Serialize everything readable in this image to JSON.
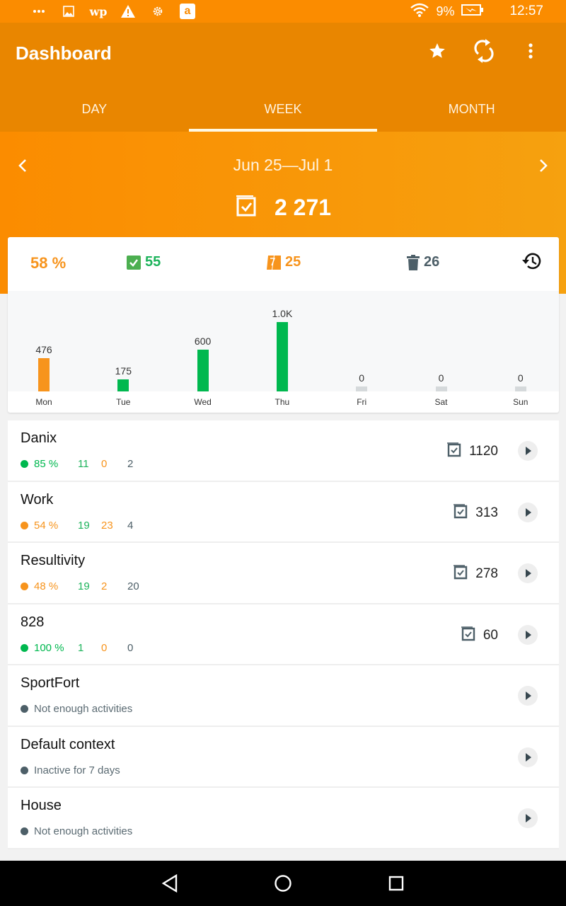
{
  "status_bar": {
    "notification_icons": [
      "more-dots-icon",
      "image-icon",
      "washington-post-icon",
      "warning-icon",
      "settings-icon",
      "amazon-icon"
    ],
    "wp_glyph": "wp",
    "amazon_glyph": "a",
    "battery": "9%",
    "time": "12:57"
  },
  "app_bar": {
    "title": "Dashboard",
    "actions": [
      "star-icon",
      "sync-icon",
      "more-vert-icon"
    ]
  },
  "tabs": [
    {
      "label": "DAY",
      "active": false
    },
    {
      "label": "WEEK",
      "active": true
    },
    {
      "label": "MONTH",
      "active": false
    }
  ],
  "period": {
    "range": "Jun 25—Jul 1",
    "prev_glyph": "‹",
    "next_glyph": "›",
    "total": "2 271"
  },
  "summary": {
    "percent": "58 %",
    "done": "55",
    "postponed": "25",
    "deleted": "26"
  },
  "colors": {
    "accent": "#fb8c00",
    "green": "#00b84f",
    "orange": "#f7941d",
    "slate": "#4d5f68",
    "empty_bar": "#d5d9db"
  },
  "chart_data": {
    "type": "bar",
    "title": "",
    "xlabel": "",
    "ylabel": "",
    "categories": [
      "Mon",
      "Tue",
      "Wed",
      "Thu",
      "Fri",
      "Sat",
      "Sun"
    ],
    "values": [
      476,
      175,
      600,
      1000,
      0,
      0,
      0
    ],
    "value_labels": [
      "476",
      "175",
      "600",
      "1.0K",
      "0",
      "0",
      "0"
    ],
    "bar_colors": [
      "#f7941d",
      "#00b84f",
      "#00b84f",
      "#00b84f",
      "#d5d9db",
      "#d5d9db",
      "#d5d9db"
    ],
    "ylim": [
      0,
      1000
    ],
    "grid": false
  },
  "contexts": [
    {
      "name": "Danix",
      "status": "good",
      "percent": "85 %",
      "done": "11",
      "postponed": "0",
      "deleted": "2",
      "count": "1120",
      "message": null
    },
    {
      "name": "Work",
      "status": "warn",
      "percent": "54 %",
      "done": "19",
      "postponed": "23",
      "deleted": "4",
      "count": "313",
      "message": null
    },
    {
      "name": "Resultivity",
      "status": "warn",
      "percent": "48 %",
      "done": "19",
      "postponed": "2",
      "deleted": "20",
      "count": "278",
      "message": null
    },
    {
      "name": "828",
      "status": "good",
      "percent": "100 %",
      "done": "1",
      "postponed": "0",
      "deleted": "0",
      "count": "60",
      "message": null
    },
    {
      "name": "SportFort",
      "status": "none",
      "message": "Not enough activities"
    },
    {
      "name": "Default context",
      "status": "none",
      "message": "Inactive for 7 days"
    },
    {
      "name": "House",
      "status": "none",
      "message": "Not enough activities"
    }
  ]
}
